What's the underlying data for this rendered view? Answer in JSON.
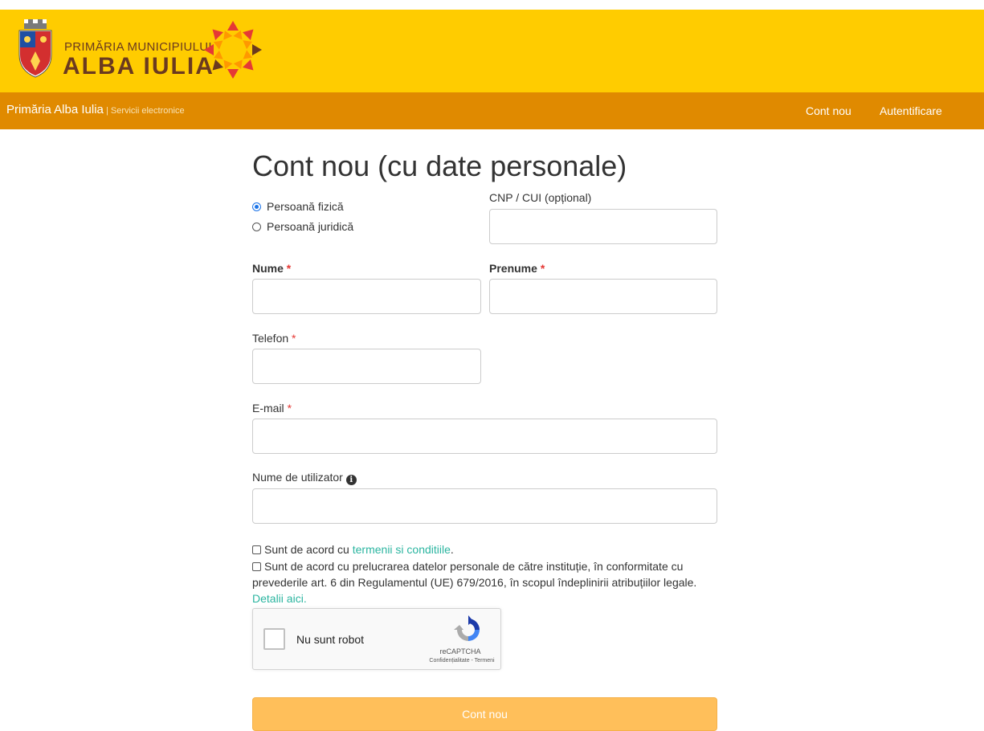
{
  "header": {
    "logo_line1": "PRIMĂRIA MUNICIPIULUI",
    "logo_line2": "ALBA IULIA"
  },
  "navbar": {
    "brand": "Primăria Alba Iulia",
    "brand_sub": " | Servicii electronice",
    "links": [
      "Cont nou",
      "Autentificare"
    ]
  },
  "form": {
    "title": "Cont nou (cu date personale)",
    "person_type": {
      "options": [
        "Persoană fizică",
        "Persoană juridică"
      ],
      "selected": "Persoană fizică"
    },
    "cnp_label": "CNP / CUI (opțional)",
    "nume_label": "Nume",
    "prenume_label": "Prenume",
    "telefon_label": "Telefon",
    "email_label": "E-mail",
    "username_label": "Nume de utilizator",
    "required_mark": "*",
    "terms_prefix": "Sunt de acord cu ",
    "terms_link": "termenii si conditiile",
    "terms_suffix": ".",
    "gdpr_text": "Sunt de acord cu prelucrarea datelor personale de către instituție, în conformitate cu prevederile art. 6 din Regulamentul (UE) 679/2016, în scopul îndeplinirii atribuțiilor legale.",
    "gdpr_link": "Detalii aici",
    "gdpr_link_suffix": ".",
    "submit_label": "Cont nou"
  },
  "captcha": {
    "label": "Nu sunt robot",
    "brand": "reCAPTCHA",
    "terms": "Confidențialitate - Termeni"
  },
  "colors": {
    "banner": "#ffcc00",
    "navbar": "#e08a00",
    "link": "#2bb5a0",
    "required": "#e53935",
    "submit": "#ffbf5a"
  }
}
